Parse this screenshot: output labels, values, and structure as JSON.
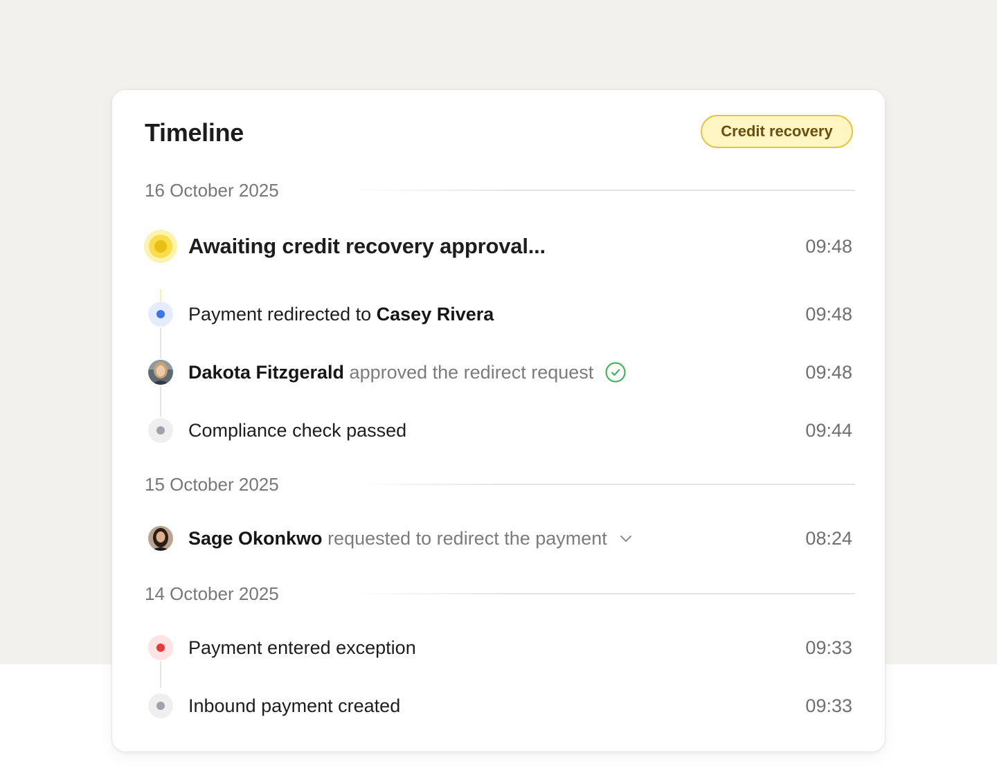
{
  "card": {
    "title": "Timeline",
    "badge": "Credit recovery"
  },
  "groups": [
    {
      "date": "16 October 2025",
      "events": [
        {
          "text": "Awaiting credit recovery approval...",
          "time": "09:48",
          "marker": "pending"
        },
        {
          "prefix": "Payment redirected to ",
          "name": "Casey Rivera",
          "time": "09:48",
          "marker": "blue-dot"
        },
        {
          "name": "Dakota Fitzgerald",
          "action": " approved the redirect request",
          "time": "09:48",
          "marker": "avatar",
          "icon": "check-circle-icon"
        },
        {
          "text": "Compliance check passed",
          "time": "09:44",
          "marker": "gray-dot"
        }
      ]
    },
    {
      "date": "15 October 2025",
      "events": [
        {
          "name": "Sage Okonkwo",
          "action": " requested to redirect the payment",
          "time": "08:24",
          "marker": "avatar",
          "icon": "chevron-down-icon"
        }
      ]
    },
    {
      "date": "14 October 2025",
      "events": [
        {
          "text": "Payment entered exception",
          "time": "09:33",
          "marker": "red-dot"
        },
        {
          "text": "Inbound payment created",
          "time": "09:33",
          "marker": "gray-dot"
        }
      ]
    }
  ],
  "colors": {
    "background": "#f2f1ed",
    "badge_fill": "#fff6c4",
    "badge_border": "#eac23b",
    "pending": "#e9be15",
    "blue": "#3b76f0",
    "red": "#e53b3b",
    "gray": "#9fa2ab",
    "success": "#2fb34a"
  }
}
